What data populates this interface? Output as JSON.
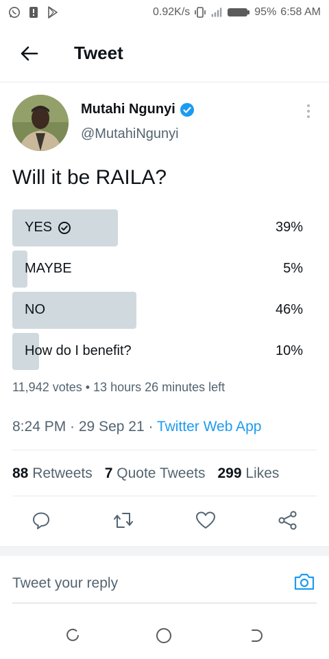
{
  "status_bar": {
    "network_speed": "0.92K/s",
    "battery": "95%",
    "time": "6:58 AM",
    "icons": [
      "whatsapp-icon",
      "sim-alert-icon",
      "play-store-icon",
      "vibrate-icon",
      "signal-icon",
      "battery-icon"
    ]
  },
  "header": {
    "title": "Tweet",
    "back_icon": "arrow-left-icon"
  },
  "author": {
    "display_name": "Mutahi Ngunyi",
    "handle": "@MutahiNgunyi",
    "verified": true
  },
  "tweet": {
    "text": "Will it be RAILA?"
  },
  "poll": {
    "options": [
      {
        "label": "YES",
        "percent": 39,
        "percent_label": "39%",
        "selected": true
      },
      {
        "label": "MAYBE",
        "percent": 5,
        "percent_label": "5%",
        "selected": false
      },
      {
        "label": "NO",
        "percent": 46,
        "percent_label": "46%",
        "selected": false
      },
      {
        "label": "How do I benefit?",
        "percent": 10,
        "percent_label": "10%",
        "selected": false
      }
    ],
    "meta": "11,942 votes • 13 hours 26 minutes left"
  },
  "timestamp": {
    "time_date": "8:24 PM · 29 Sep 21 · ",
    "source": "Twitter Web App"
  },
  "stats": {
    "retweets_count": "88",
    "retweets_label": "Retweets",
    "quotes_count": "7",
    "quotes_label": "Quote Tweets",
    "likes_count": "299",
    "likes_label": "Likes"
  },
  "actions": [
    "reply-icon",
    "retweet-icon",
    "like-icon",
    "share-icon"
  ],
  "reply": {
    "placeholder": "Tweet your reply"
  },
  "colors": {
    "accent": "#1d9bf0",
    "poll_bar": "#cfd9de",
    "text_primary": "#0f1419",
    "text_secondary": "#536471"
  }
}
